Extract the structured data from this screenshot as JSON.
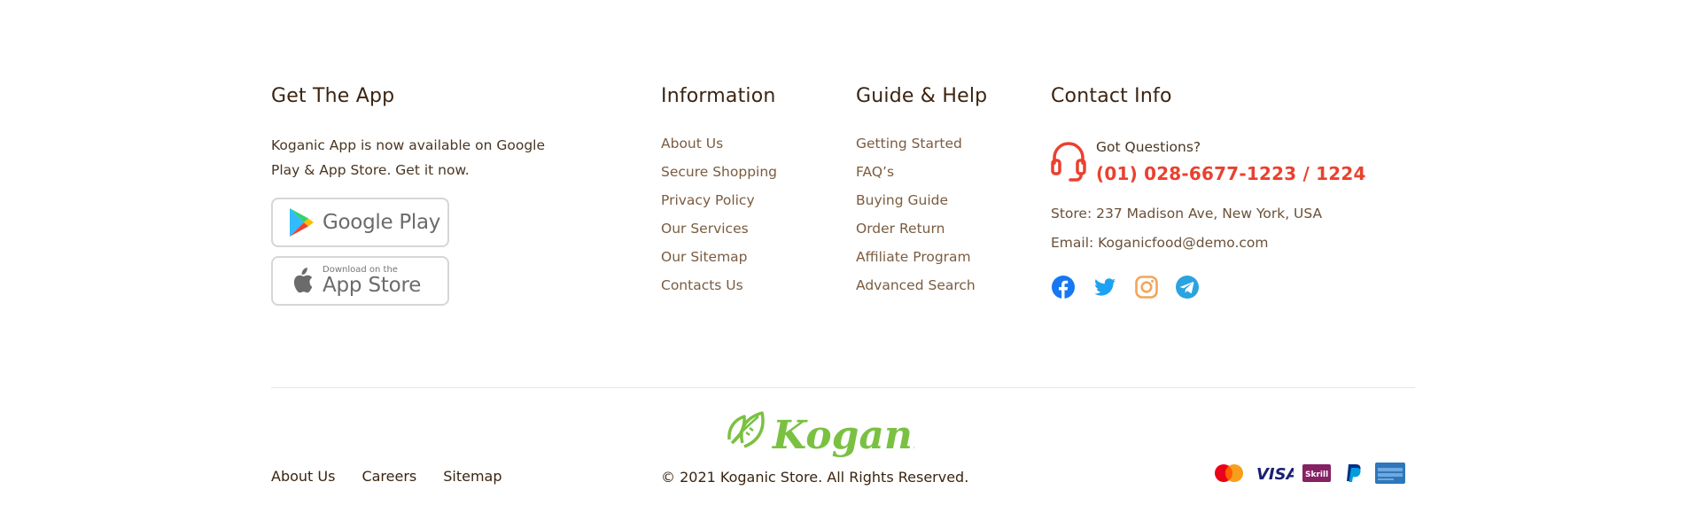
{
  "get_app": {
    "title": "Get The App",
    "description": "Koganic App is now available on Google Play & App Store. Get it now.",
    "google_play_label": "Google Play",
    "app_store_small": "Download on the",
    "app_store_label": "App Store"
  },
  "information": {
    "title": "Information",
    "links": [
      "About Us",
      "Secure Shopping",
      "Privacy Policy",
      "Our Services",
      "Our Sitemap",
      "Contacts Us"
    ]
  },
  "guide": {
    "title": "Guide & Help",
    "links": [
      "Getting Started",
      "FAQ’s",
      "Buying Guide",
      "Order Return",
      "Affiliate Program",
      "Advanced Search"
    ]
  },
  "contact": {
    "title": "Contact Info",
    "question": "Got Questions?",
    "phone": "(01) 028-6677-1223 / 1224",
    "store": "Store: 237 Madison Ave, New York, USA",
    "email": "Email: Koganicfood@demo.com",
    "accent_color": "#e9412f",
    "social": [
      "facebook-icon",
      "twitter-icon",
      "instagram-icon",
      "telegram-icon"
    ]
  },
  "bottom": {
    "links": [
      "About Us",
      "Careers",
      "Sitemap"
    ],
    "logo_text": "Koganic",
    "copyright": "© 2021 Koganic Store. All Rights Reserved.",
    "payments": [
      "mastercard-icon",
      "visa-icon",
      "skrill-icon",
      "paypal-icon",
      "amex-icon"
    ],
    "visa_text": "VISA",
    "skrill_text": "Skrill",
    "brand_color": "#7ac142"
  }
}
